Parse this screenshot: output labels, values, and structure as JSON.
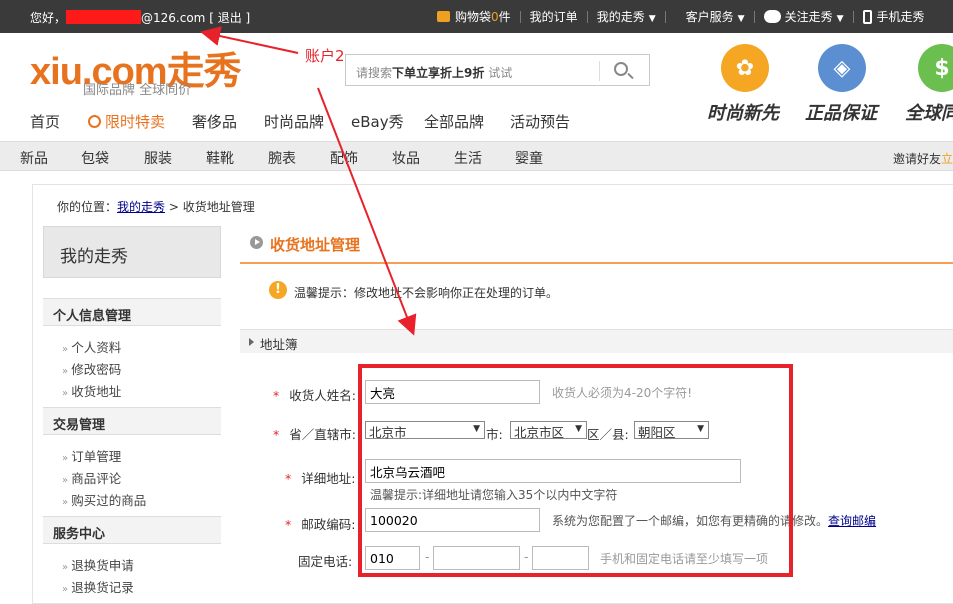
{
  "topbar": {
    "greet_prefix": "您好，",
    "email_suffix": "@126.com",
    "logout": "[ 退出 ]",
    "cart_label": "购物袋",
    "cart_count": "0",
    "cart_unit": "件",
    "my_orders": "我的订单",
    "my_xiu": "我的走秀",
    "customer_service": "客户服务",
    "follow": "关注走秀",
    "mobile": "手机走秀"
  },
  "header": {
    "logo_main": "xiu.com",
    "logo_cn": "走秀",
    "slogan": "国际品牌   全球同价",
    "annotation": "账户2",
    "search_placeholder_pre": "请搜索",
    "search_placeholder_bold": "下单立享折上9折",
    "search_placeholder_post": " 试试",
    "badges": [
      {
        "label": "时尚新先",
        "color": "#f5a623"
      },
      {
        "label": "正品保证",
        "color": "#5b8fd1"
      },
      {
        "label": "全球同",
        "color": "#6bbf4e"
      }
    ]
  },
  "mainnav": [
    "首页",
    "限时特卖",
    "奢侈品",
    "时尚品牌",
    "eBay秀",
    "全部品牌",
    "活动预告"
  ],
  "catbar": {
    "items": [
      "新品",
      "包袋",
      "服装",
      "鞋靴",
      "腕表",
      "配饰",
      "妆品",
      "生活",
      "婴童"
    ],
    "invite": "邀请好友",
    "invite_more": "立"
  },
  "breadcrumb": {
    "prefix": "你的位置：",
    "link": "我的走秀",
    "current": " > 收货地址管理"
  },
  "sidebar": {
    "title": "我的走秀",
    "sections": [
      {
        "title": "个人信息管理",
        "links": [
          "个人资料",
          "修改密码",
          "收货地址"
        ]
      },
      {
        "title": "交易管理",
        "links": [
          "订单管理",
          "商品评论",
          "购买过的商品"
        ]
      },
      {
        "title": "服务中心",
        "links": [
          "退换货申请",
          "退换货记录"
        ]
      }
    ]
  },
  "content": {
    "title": "收货地址管理",
    "tip": "温馨提示：修改地址不会影响你正在处理的订单。",
    "address_book": "地址簿"
  },
  "form": {
    "name_label": "收货人姓名:",
    "name_value": "大亮",
    "name_hint": "收货人必须为4-20个字符!",
    "region_label": "省／直辖市:",
    "province": "北京市",
    "city_sep": "市:",
    "city": "北京市区",
    "district_sep": "区／县:",
    "district": "朝阳区",
    "address_label": "详细地址:",
    "address_value": "北京乌云酒吧",
    "address_hint": "温馨提示:详细地址请您输入35个以内中文字符",
    "zip_label": "邮政编码:",
    "zip_value": "100020",
    "zip_hint": "系统为您配置了一个邮编，如您有更精确的请修改。",
    "zip_link": "查询邮编",
    "phone_label": "固定电话:",
    "phone_area": "010",
    "phone_hint": "手机和固定电话请至少填写一项"
  }
}
